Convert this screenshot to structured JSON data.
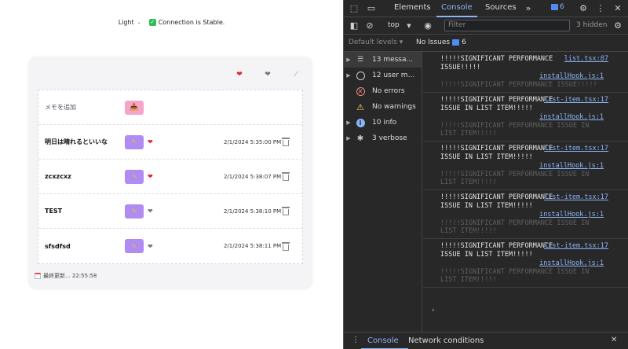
{
  "app": {
    "theme_label": "Light",
    "connection_status": "Connection is Stable.",
    "memo_placeholder": "メモを追加",
    "items": [
      {
        "title": "明日は晴れるといいな",
        "favorite": true,
        "timestamp": "2/1/2024 5:35:00 PM"
      },
      {
        "title": "zcxzcxz",
        "favorite": true,
        "timestamp": "2/1/2024 5:38:07 PM"
      },
      {
        "title": "TEST",
        "favorite": false,
        "timestamp": "2/1/2024 5:38:10 PM"
      },
      {
        "title": "sfsdfsd",
        "favorite": false,
        "timestamp": "2/1/2024 5:38:11 PM"
      }
    ],
    "footer": "最終更新... 22:55:58"
  },
  "devtools": {
    "tabs": [
      "Elements",
      "Console",
      "Sources"
    ],
    "active_tab": "Console",
    "message_count": "6",
    "context": "top",
    "filter_placeholder": "Filter",
    "hidden_count": "3 hidden",
    "levels": "Default levels",
    "issues_label": "No Issues",
    "issues_count": "6",
    "sidebar": [
      {
        "label": "13 messa...",
        "icon": "list-icon",
        "expandable": true
      },
      {
        "label": "12 user m...",
        "icon": "user-icon",
        "expandable": true
      },
      {
        "label": "No errors",
        "icon": "error-icon",
        "expandable": false
      },
      {
        "label": "No warnings",
        "icon": "warning-icon",
        "expandable": false
      },
      {
        "label": "10 info",
        "icon": "info-icon",
        "expandable": true
      },
      {
        "label": "3 verbose",
        "icon": "bug-icon",
        "expandable": true
      }
    ],
    "logs": [
      {
        "text": "!!!!!SIGNIFICANT PERFORMANCE ISSUE!!!!!",
        "source": "list.tsx:87",
        "hook": "installHook.js:1",
        "ghost": "!!!!!SIGNIFICANT PERFORMANCE ISSUE!!!!!"
      },
      {
        "text": "!!!!!SIGNIFICANT PERFORMANCE ISSUE IN LIST ITEM!!!!!",
        "source": "list-item.tsx:17",
        "hook": "installHook.js:1",
        "ghost": "!!!!!SIGNIFICANT PERFORMANCE ISSUE IN LIST ITEM!!!!!"
      },
      {
        "text": "!!!!!SIGNIFICANT PERFORMANCE ISSUE IN LIST ITEM!!!!!",
        "source": "list-item.tsx:17",
        "hook": "installHook.js:1",
        "ghost": "!!!!!SIGNIFICANT PERFORMANCE ISSUE IN LIST ITEM!!!!!"
      },
      {
        "text": "!!!!!SIGNIFICANT PERFORMANCE ISSUE IN LIST ITEM!!!!!",
        "source": "list-item.tsx:17",
        "hook": "installHook.js:1",
        "ghost": "!!!!!SIGNIFICANT PERFORMANCE ISSUE IN LIST ITEM!!!!!"
      },
      {
        "text": "!!!!!SIGNIFICANT PERFORMANCE ISSUE IN LIST ITEM!!!!!",
        "source": "list-item.tsx:17",
        "hook": "installHook.js:1",
        "ghost": "!!!!!SIGNIFICANT PERFORMANCE ISSUE IN LIST ITEM!!!!!"
      }
    ],
    "drawer_tabs": [
      "Console",
      "Network conditions"
    ]
  },
  "colors": {
    "devtools_bg": "#282828",
    "accent_blue": "#8ab4f8",
    "edit_button": "#b08cf2",
    "add_button": "#f4a6c8",
    "heart_red": "#e0242f"
  }
}
